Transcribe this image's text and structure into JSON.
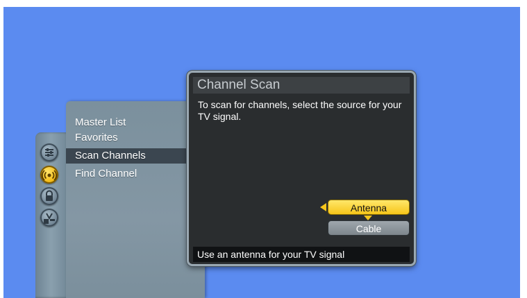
{
  "theme": {
    "background": "#5b8bf0",
    "accent": "#f6c51a",
    "panel": "#8497a4",
    "dialog": "#2a2d2f"
  },
  "rail": {
    "icons": [
      "settings-icon",
      "antenna-signal-icon",
      "lock-icon",
      "v-chip-icon"
    ],
    "active_index": 1
  },
  "menu": {
    "items": [
      {
        "label": "Master List"
      },
      {
        "label": "Favorites"
      },
      {
        "label": "Scan Channels",
        "selected": true
      },
      {
        "label": "Find Channel"
      }
    ]
  },
  "dialog": {
    "title": "Channel Scan",
    "message": "To scan for channels, select the source for your TV signal.",
    "options": [
      {
        "label": "Antenna",
        "highlighted": true
      },
      {
        "label": "Cable"
      }
    ],
    "footer": "Use an antenna for your TV signal"
  }
}
